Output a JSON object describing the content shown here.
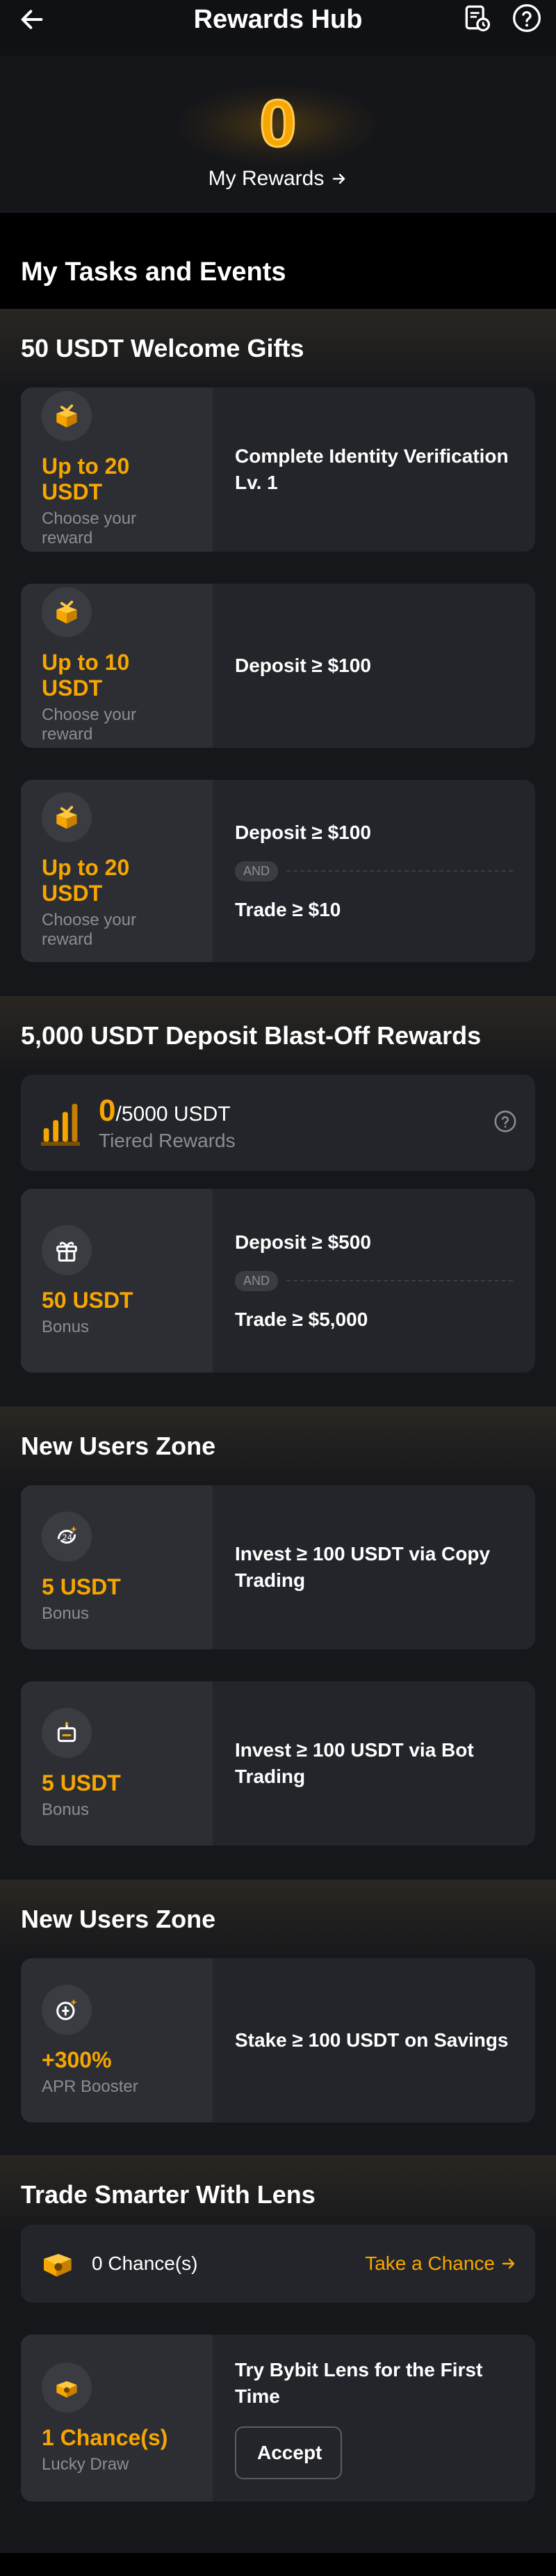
{
  "header": {
    "title": "Rewards Hub"
  },
  "hero": {
    "reward_count": "0",
    "my_rewards_label": "My Rewards"
  },
  "tasks_heading": "My Tasks and Events",
  "welcome": {
    "title": "50 USDT Welcome Gifts",
    "cards": [
      {
        "amount": "Up to 20 USDT",
        "sub": "Choose your reward",
        "task": "Complete Identity Verification Lv. 1"
      },
      {
        "amount": "Up to 10 USDT",
        "sub": "Choose your reward",
        "task": "Deposit ≥ $100"
      },
      {
        "amount": "Up to 20 USDT",
        "sub": "Choose your reward",
        "task1": "Deposit ≥ $100",
        "and": "AND",
        "task2": "Trade ≥ $10"
      }
    ]
  },
  "blastoff": {
    "title": "5,000 USDT Deposit Blast-Off Rewards",
    "tier_current": "0",
    "tier_total": "/5000 USDT",
    "tier_label": "Tiered Rewards",
    "card": {
      "amount": "50 USDT",
      "sub": "Bonus",
      "task1": "Deposit ≥ $500",
      "and": "AND",
      "task2": "Trade ≥ $5,000"
    }
  },
  "new_users_1": {
    "title": "New Users Zone",
    "cards": [
      {
        "amount": "5 USDT",
        "sub": "Bonus",
        "task": "Invest ≥ 100 USDT via Copy Trading"
      },
      {
        "amount": "5 USDT",
        "sub": "Bonus",
        "task": "Invest ≥ 100 USDT via Bot Trading"
      }
    ]
  },
  "new_users_2": {
    "title": "New Users Zone",
    "card": {
      "amount": "+300%",
      "sub": "APR Booster",
      "task": "Stake ≥ 100 USDT on Savings"
    }
  },
  "lens": {
    "title": "Trade Smarter With Lens",
    "chances": "0 Chance(s)",
    "take_label": "Take a Chance",
    "card": {
      "amount": "1 Chance(s)",
      "sub": "Lucky Draw",
      "task": "Try Bybit Lens for the First Time",
      "accept": "Accept"
    }
  },
  "colors": {
    "accent": "#f7a600",
    "card": "#23252a",
    "card_left": "#2c2e33",
    "muted": "#8b8d93"
  }
}
